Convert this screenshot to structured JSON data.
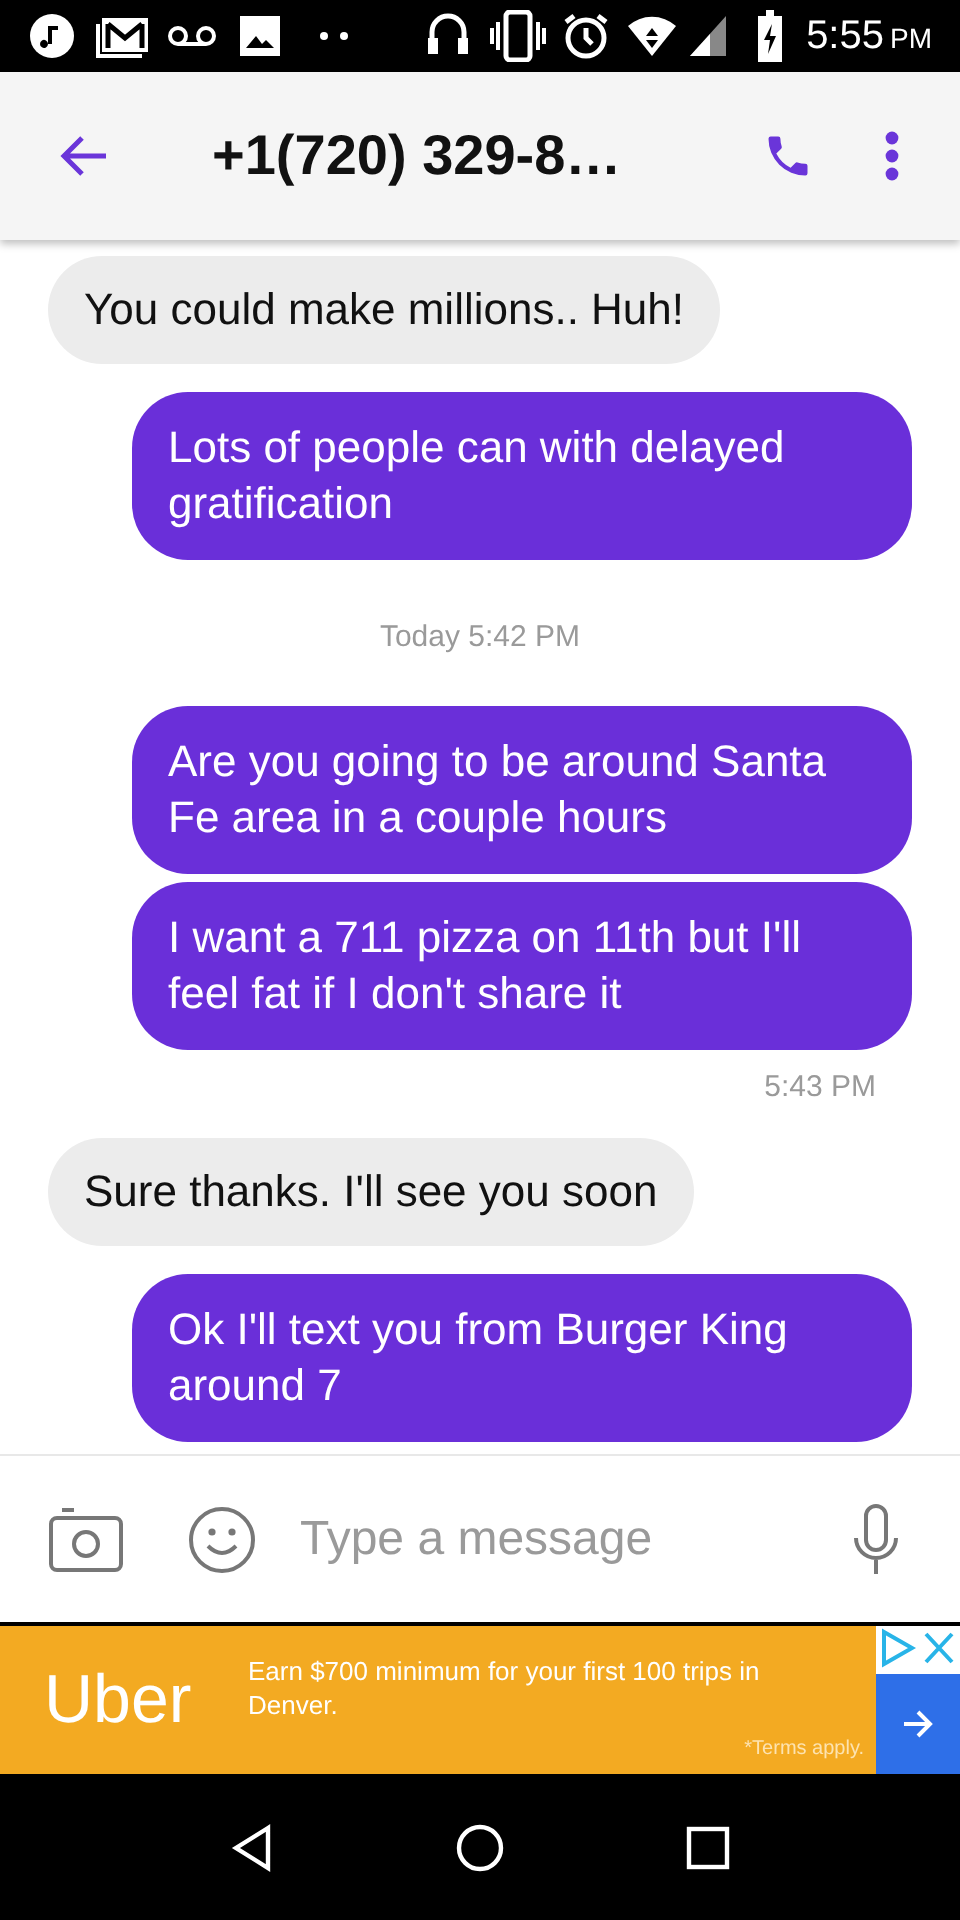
{
  "status_bar": {
    "time": "5:55",
    "ampm": "PM"
  },
  "header": {
    "title": "+1(720) 329-8…"
  },
  "messages": [
    {
      "kind": "incoming",
      "text": "You could make millions.. Huh!"
    },
    {
      "kind": "outgoing",
      "text": "Lots of people can with delayed gratification"
    },
    {
      "kind": "divider",
      "text": "Today 5:42 PM"
    },
    {
      "kind": "outgoing",
      "text": "Are you going to be around Santa Fe area in a couple hours"
    },
    {
      "kind": "outgoing",
      "text": "I want a 711 pizza on 11th but I'll feel fat if I don't share it"
    },
    {
      "kind": "sent_time",
      "text": "5:43 PM"
    },
    {
      "kind": "incoming",
      "text": "Sure thanks. I'll see you soon"
    },
    {
      "kind": "outgoing",
      "text": "Ok I'll text you from Burger King around 7"
    }
  ],
  "composer": {
    "placeholder": "Type a message"
  },
  "ad": {
    "brand": "Uber",
    "text": "Earn $700 minimum for your first 100 trips in Denver.",
    "terms": "*Terms apply."
  }
}
